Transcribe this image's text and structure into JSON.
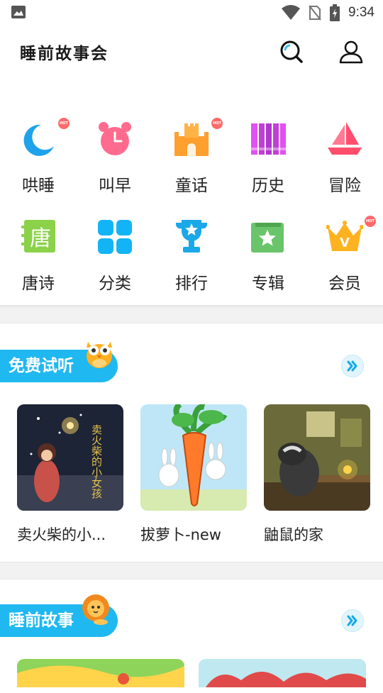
{
  "status": {
    "time": "9:34"
  },
  "header": {
    "title": "睡前故事会"
  },
  "categories": [
    {
      "label": "哄睡",
      "icon": "moon-sleep-icon",
      "hot": true,
      "hot_text": "HOT"
    },
    {
      "label": "叫早",
      "icon": "alarm-clock-icon",
      "hot": false
    },
    {
      "label": "童话",
      "icon": "castle-icon",
      "hot": true,
      "hot_text": "HOT"
    },
    {
      "label": "历史",
      "icon": "bookshelf-icon",
      "hot": false
    },
    {
      "label": "冒险",
      "icon": "sailboat-icon",
      "hot": false
    },
    {
      "label": "唐诗",
      "icon": "tang-poetry-icon",
      "icon_char": "唐",
      "hot": false
    },
    {
      "label": "分类",
      "icon": "grid-icon",
      "hot": false
    },
    {
      "label": "排行",
      "icon": "trophy-icon",
      "hot": false
    },
    {
      "label": "专辑",
      "icon": "album-star-icon",
      "hot": false
    },
    {
      "label": "会员",
      "icon": "crown-icon",
      "hot": true,
      "hot_text": "HOT"
    }
  ],
  "sections": [
    {
      "title": "免费试听",
      "mascot": "owl-icon",
      "stories": [
        {
          "title": "卖火柴的小...",
          "cover": "match-girl-cover",
          "cover_text": "卖火柴的小女孩"
        },
        {
          "title": "拔萝卜-new",
          "cover": "carrot-bunnies-cover"
        },
        {
          "title": "鼬鼠的家",
          "cover": "badger-home-cover"
        }
      ]
    },
    {
      "title": "睡前故事",
      "mascot": "lion-icon"
    }
  ],
  "colors": {
    "accent": "#20b8f0",
    "hot": "#ff6a6a",
    "page_bg": "#f2f2f2"
  }
}
